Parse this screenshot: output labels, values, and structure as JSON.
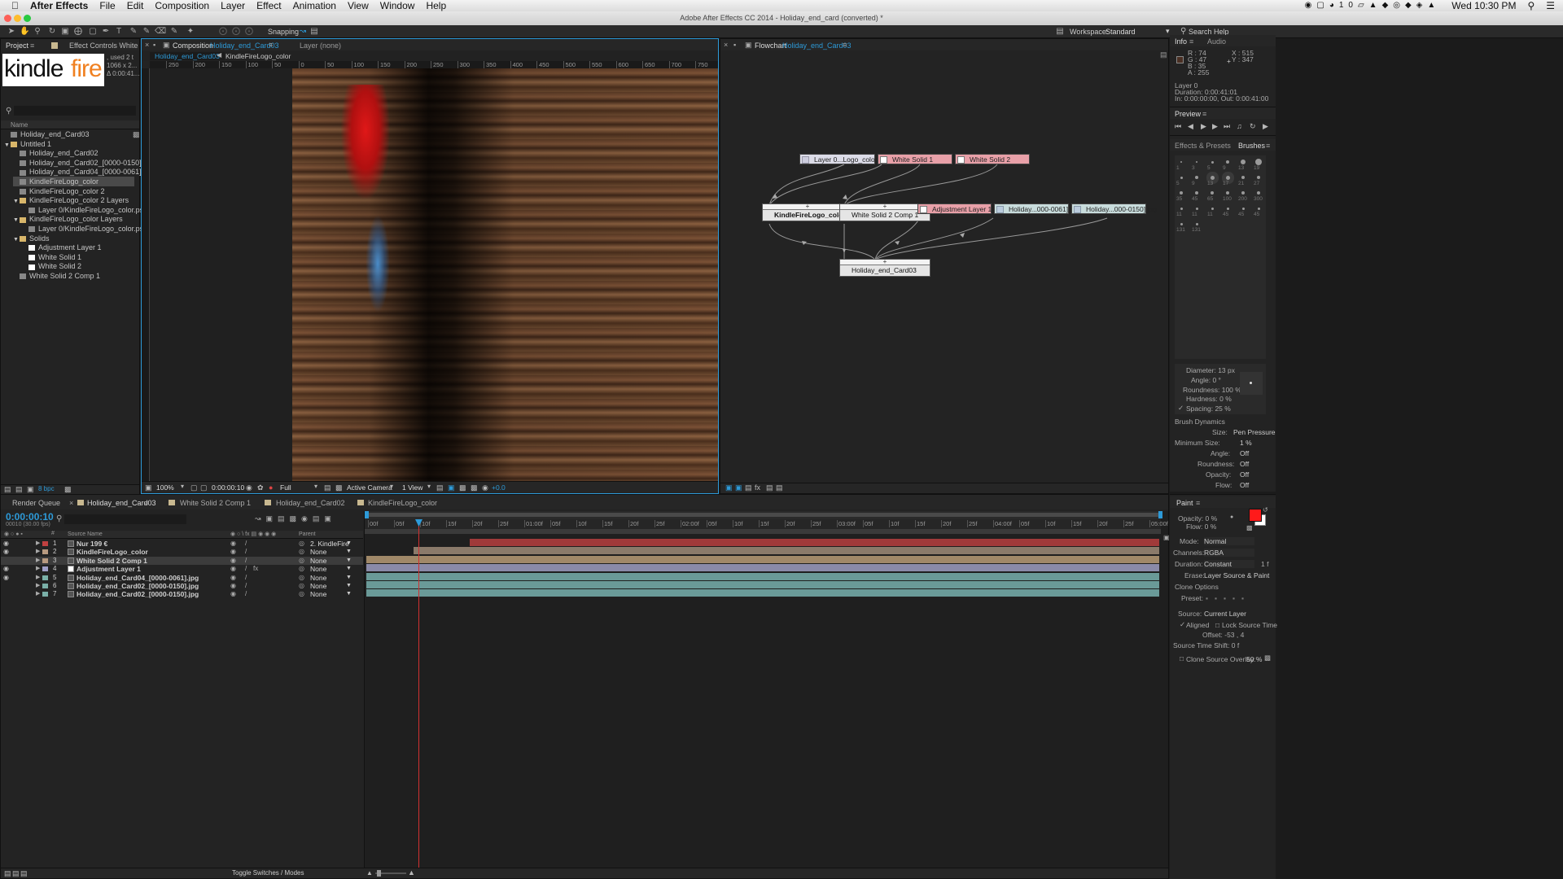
{
  "menubar": {
    "app": "After Effects",
    "items": [
      "File",
      "Edit",
      "Composition",
      "Layer",
      "Effect",
      "Animation",
      "View",
      "Window",
      "Help"
    ],
    "clock": "Wed 10:30 PM",
    "badge": "10"
  },
  "title": "Adobe After Effects CC 2014 - Holiday_end_card (converted) *",
  "toolbar": {
    "snapping": "Snapping",
    "workspace_label": "Workspace:",
    "workspace_value": "Standard",
    "search": "Search Help"
  },
  "project": {
    "tab": "Project",
    "effect_tab": "Effect Controls White Solid",
    "thumb_word1": "kindle",
    "thumb_word2": "fire",
    "info_l1": ", used 2 t",
    "info_l2": "1066 x 2...",
    "info_l3": "Δ 0:00:41...",
    "col_name": "Name",
    "items": [
      {
        "label": "Holiday_end_Card03",
        "indent": 0,
        "color": "#888",
        "arrow": ""
      },
      {
        "label": "Untitled 1",
        "indent": 0,
        "color": "#d8b66a",
        "arrow": "▼"
      },
      {
        "label": "Holiday_end_Card02",
        "indent": 1,
        "color": "#888",
        "arrow": ""
      },
      {
        "label": "Holiday_end_Card02_[0000-0150].jpg",
        "indent": 1,
        "color": "#888",
        "arrow": ""
      },
      {
        "label": "Holiday_end_Card04_[0000-0061].jpg",
        "indent": 1,
        "color": "#888",
        "arrow": ""
      },
      {
        "label": "KindleFireLogo_color",
        "indent": 1,
        "color": "#888",
        "arrow": ""
      },
      {
        "label": "KindleFireLogo_color 2",
        "indent": 1,
        "color": "#888",
        "arrow": ""
      },
      {
        "label": "KindleFireLogo_color 2 Layers",
        "indent": 1,
        "color": "#d8b66a",
        "arrow": "▼"
      },
      {
        "label": "Layer 0/KindleFireLogo_color.psd",
        "indent": 2,
        "color": "#888",
        "arrow": ""
      },
      {
        "label": "KindleFireLogo_color Layers",
        "indent": 1,
        "color": "#d8b66a",
        "arrow": "▼"
      },
      {
        "label": "Layer 0/KindleFireLogo_color.psd",
        "indent": 2,
        "color": "#888",
        "arrow": ""
      },
      {
        "label": "Solids",
        "indent": 1,
        "color": "#d8b66a",
        "arrow": "▼"
      },
      {
        "label": "Adjustment Layer 1",
        "indent": 2,
        "color": "#fff",
        "arrow": ""
      },
      {
        "label": "White Solid 1",
        "indent": 2,
        "color": "#fff",
        "arrow": ""
      },
      {
        "label": "White Solid 2",
        "indent": 2,
        "color": "#fff",
        "arrow": ""
      },
      {
        "label": "White Solid 2 Comp 1",
        "indent": 1,
        "color": "#888",
        "arrow": ""
      }
    ],
    "bpc": "8 bpc"
  },
  "comp": {
    "tab": "Composition",
    "tab_name": "Holiday_end_Card03",
    "layer_tab": "Layer (none)",
    "sub1": "Holiday_end_Card03",
    "sub2": "KindleFireLogo_color",
    "ruler": [
      "250",
      "200",
      "150",
      "100",
      "50",
      "0",
      "50",
      "100",
      "150",
      "200",
      "250",
      "300",
      "350",
      "400",
      "450",
      "500",
      "550",
      "600",
      "650",
      "700",
      "750",
      "800"
    ],
    "zoom": "100%",
    "time": "0:00:00:10",
    "res": "Full",
    "camera": "Active Camera",
    "view": "1 View",
    "exposure": "+0.0"
  },
  "flow": {
    "tab": "Flowchart",
    "tab_name": "Holiday_end_Card03",
    "nodes": {
      "psd": "Layer 0...Logo_color.psd",
      "ws1": "White Solid 1",
      "ws2": "White Solid 2",
      "kfl": "KindleFireLogo_color",
      "ws2c": "White Solid 2 Comp 1",
      "adj": "Adjustment Layer 1",
      "h1": "Holiday...000-0061].jpg",
      "h2": "Holiday...000-0150].jpg",
      "out": "Holiday_end_Card03"
    }
  },
  "info": {
    "tab": "Info",
    "audio": "Audio",
    "r": "R : 74",
    "g": "G : 47",
    "b": "B : 35",
    "a": "A : 255",
    "x": "X : 515",
    "y": "Y : 347",
    "l1": "Layer 0",
    "l2": "Duration: 0:00:41:01",
    "l3": "In: 0:00:00:00, Out: 0:00:41:00",
    "swatch": "#4a2f23"
  },
  "preview": {
    "tab": "Preview"
  },
  "brushes": {
    "effects_tab": "Effects & Presets",
    "tab": "Brushes",
    "sizes": [
      "1",
      "3",
      "5",
      "9",
      "13",
      "19",
      "5",
      "9",
      "13",
      "17",
      "21",
      "27",
      "35",
      "45",
      "65",
      "100",
      "200",
      "300",
      "11",
      "11",
      "11",
      "45",
      "45",
      "45",
      "131",
      "131"
    ],
    "diameter": "Diameter: 13 px",
    "angle": "Angle: 0 °",
    "roundness": "Roundness: 100 %",
    "hardness": "Hardness: 0 %",
    "spacing": "Spacing: 25 %",
    "dynamics": "Brush Dynamics",
    "size_l": "Size:",
    "size_v": "Pen Pressure",
    "min_l": "Minimum Size:",
    "min_v": "1 %",
    "ang_l": "Angle:",
    "ang_v": "Off",
    "rnd_l": "Roundness:",
    "rnd_v": "Off",
    "op_l": "Opacity:",
    "op_v": "Off",
    "fl_l": "Flow:",
    "fl_v": "Off"
  },
  "timeline": {
    "tabs": [
      "Render Queue",
      "Holiday_end_Card03",
      "White Solid 2 Comp 1",
      "Holiday_end_Card02",
      "KindleFireLogo_color"
    ],
    "time": "0:00:00:10",
    "fps": "00010 (30.00 fps)",
    "col_source": "Source Name",
    "col_parent": "Parent",
    "toggle": "Toggle Switches / Modes",
    "ruler": [
      "00f",
      "05f",
      "10f",
      "15f",
      "20f",
      "25f",
      "01:00f",
      "05f",
      "10f",
      "15f",
      "20f",
      "25f",
      "02:00f",
      "05f",
      "10f",
      "15f",
      "20f",
      "25f",
      "03:00f",
      "05f",
      "10f",
      "15f",
      "20f",
      "25f",
      "04:00f",
      "05f",
      "10f",
      "15f",
      "20f",
      "25f",
      "05:00f"
    ],
    "layers": [
      {
        "num": "1",
        "name": "Nur 199 €",
        "color": "#c04040",
        "parent": "2. KindleFire",
        "bar": "#a03a3a",
        "bar_start": 0.13,
        "type": "T"
      },
      {
        "num": "2",
        "name": "KindleFireLogo_color",
        "color": "#b89a80",
        "parent": "None",
        "bar": "#8a7a6a",
        "bar_start": 0.06,
        "type": "c"
      },
      {
        "num": "3",
        "name": "White Solid 2 Comp 1",
        "color": "#b89a80",
        "parent": "None",
        "bar": "#a08868",
        "bar_start": 0,
        "type": "c"
      },
      {
        "num": "4",
        "name": "Adjustment Layer 1",
        "color": "#a0a0c8",
        "parent": "None",
        "bar": "#8a8aa8",
        "bar_start": 0,
        "type": "s"
      },
      {
        "num": "5",
        "name": "Holiday_end_Card04_[0000-0061].jpg",
        "color": "#7ab0a8",
        "parent": "None",
        "bar": "#6a9a98",
        "bar_start": 0,
        "type": "c"
      },
      {
        "num": "6",
        "name": "Holiday_end_Card02_[0000-0150].jpg",
        "color": "#7ab0a8",
        "parent": "None",
        "bar": "#6a9a98",
        "bar_start": 0,
        "type": "c"
      },
      {
        "num": "7",
        "name": "Holiday_end_Card02_[0000-0150].jpg",
        "color": "#7ab0a8",
        "parent": "None",
        "bar": "#6a9a98",
        "bar_start": 0,
        "type": "c"
      }
    ]
  },
  "paint": {
    "tab": "Paint",
    "opacity": "Opacity: 0 %",
    "flow": "Flow: 0 %",
    "mode_l": "Mode:",
    "mode_v": "Normal",
    "chan_l": "Channels:",
    "chan_v": "RGBA",
    "dur_l": "Duration:",
    "dur_v": "Constant",
    "dur_n": "1 f",
    "erase_l": "Erase:",
    "erase_v": "Layer Source & Paint",
    "clone": "Clone Options",
    "preset": "Preset:",
    "source_l": "Source:",
    "source_v": "Current Layer",
    "aligned": "Aligned",
    "lock": "Lock Source Time",
    "offset": "Offset: -53 , 4",
    "shift": "Source Time Shift: 0 f",
    "overlay": "Clone Source Overlay:",
    "overlay_v": "50 %",
    "fg": "#ff1a1a"
  }
}
